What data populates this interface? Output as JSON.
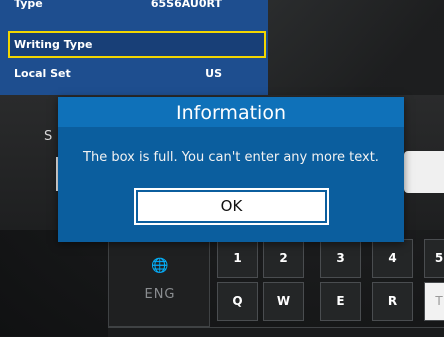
{
  "settings": {
    "rows": [
      {
        "label": "Type",
        "value": "65S6AU0RT"
      },
      {
        "label": "Writing Type",
        "value": ""
      },
      {
        "label": "Local Set",
        "value": "US"
      }
    ]
  },
  "background": {
    "partial_label": "S"
  },
  "dialog": {
    "title": "Information",
    "message": "The box is full. You can't enter any more text.",
    "ok_label": "OK"
  },
  "keyboard": {
    "language_label": "ENG",
    "number_row": [
      "1",
      "2",
      "3",
      "4",
      "5"
    ],
    "letter_row": [
      "Q",
      "W",
      "E",
      "R",
      "T"
    ]
  },
  "colors": {
    "settings_bg": "#1e4e8f",
    "focus_border": "#f2d600",
    "dialog_bg": "#0b5e9e",
    "dialog_title_bg": "#0f71b9"
  }
}
